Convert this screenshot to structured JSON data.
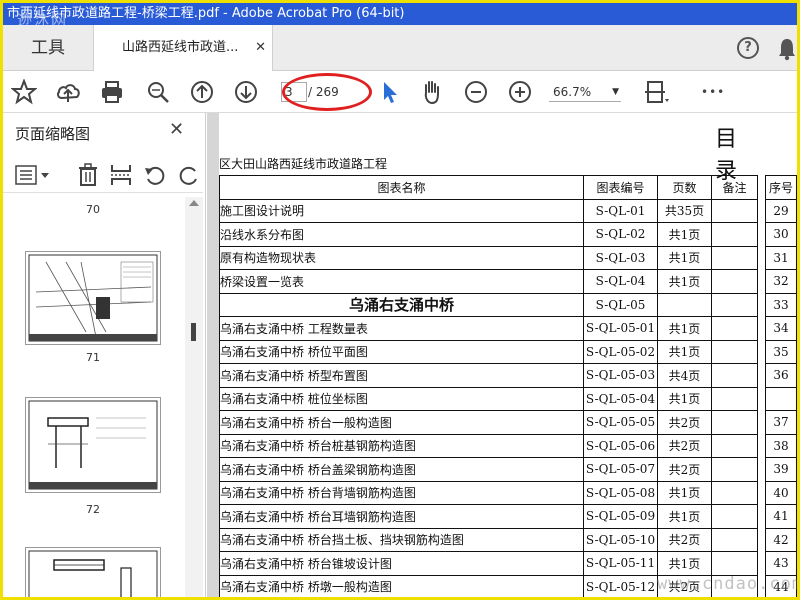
{
  "window": {
    "title": "市西延线市政道路工程-桥梁工程.pdf - Adobe Acrobat Pro (64-bit)",
    "watermark": "迹沐网"
  },
  "tabs": {
    "tools": "工具",
    "document": "山路西延线市政道...",
    "close": "✕",
    "help": "?"
  },
  "toolbar": {
    "page_current": "3",
    "page_total": "/ 269",
    "zoom": "66.7%",
    "zoom_caret": "▼",
    "more": "•••"
  },
  "sidebar": {
    "title": "页面缩略图",
    "close": "✕",
    "thumb_labels": [
      "70",
      "71",
      "72"
    ]
  },
  "document": {
    "heading": "目录",
    "project": "区大田山路西延线市政道路工程",
    "headers": [
      "图表名称",
      "图表编号",
      "页数",
      "备注"
    ],
    "seq_header": "序号",
    "rows": [
      {
        "name": "施工图设计说明",
        "code": "S-QL-01",
        "pages": "共35页",
        "seq": "29"
      },
      {
        "name": "沿线水系分布图",
        "code": "S-QL-02",
        "pages": "共1页",
        "seq": "30"
      },
      {
        "name": "原有构造物现状表",
        "code": "S-QL-03",
        "pages": "共1页",
        "seq": "31"
      },
      {
        "name": "桥梁设置一览表",
        "code": "S-QL-04",
        "pages": "共1页",
        "seq": "32"
      },
      {
        "name": "乌涌右支涌中桥",
        "code": "S-QL-05",
        "pages": "",
        "seq": "33",
        "section": true
      },
      {
        "name": "乌涌右支涌中桥 工程数量表",
        "code": "S-QL-05-01",
        "pages": "共1页",
        "seq": "34"
      },
      {
        "name": "乌涌右支涌中桥 桥位平面图",
        "code": "S-QL-05-02",
        "pages": "共1页",
        "seq": "35"
      },
      {
        "name": "乌涌右支涌中桥 桥型布置图",
        "code": "S-QL-05-03",
        "pages": "共4页",
        "seq": "36"
      },
      {
        "name": "乌涌右支涌中桥 桩位坐标图",
        "code": "S-QL-05-04",
        "pages": "共1页",
        "seq": ""
      },
      {
        "name": "乌涌右支涌中桥 桥台一般构造图",
        "code": "S-QL-05-05",
        "pages": "共2页",
        "seq": "37"
      },
      {
        "name": "乌涌右支涌中桥 桥台桩基钢筋构造图",
        "code": "S-QL-05-06",
        "pages": "共2页",
        "seq": "38"
      },
      {
        "name": "乌涌右支涌中桥 桥台盖梁钢筋构造图",
        "code": "S-QL-05-07",
        "pages": "共2页",
        "seq": "39"
      },
      {
        "name": "乌涌右支涌中桥 桥台背墙钢筋构造图",
        "code": "S-QL-05-08",
        "pages": "共1页",
        "seq": "40"
      },
      {
        "name": "乌涌右支涌中桥 桥台耳墙钢筋构造图",
        "code": "S-QL-05-09",
        "pages": "共1页",
        "seq": "41"
      },
      {
        "name": "乌涌右支涌中桥 桥台挡土板、挡块钢筋构造图",
        "code": "S-QL-05-10",
        "pages": "共2页",
        "seq": "42"
      },
      {
        "name": "乌涌右支涌中桥 桥台锥坡设计图",
        "code": "S-QL-05-11",
        "pages": "共1页",
        "seq": "43"
      },
      {
        "name": "乌涌右支涌中桥 桥墩一般构造图",
        "code": "S-QL-05-12",
        "pages": "共2页",
        "seq": "44"
      }
    ]
  },
  "watermark_br": "www.cndao.com",
  "colors": {
    "titlebar": "#2a5bd7",
    "highlight": "#e02020",
    "frame": "#f0e000",
    "cursor": "#2a6fd6"
  }
}
